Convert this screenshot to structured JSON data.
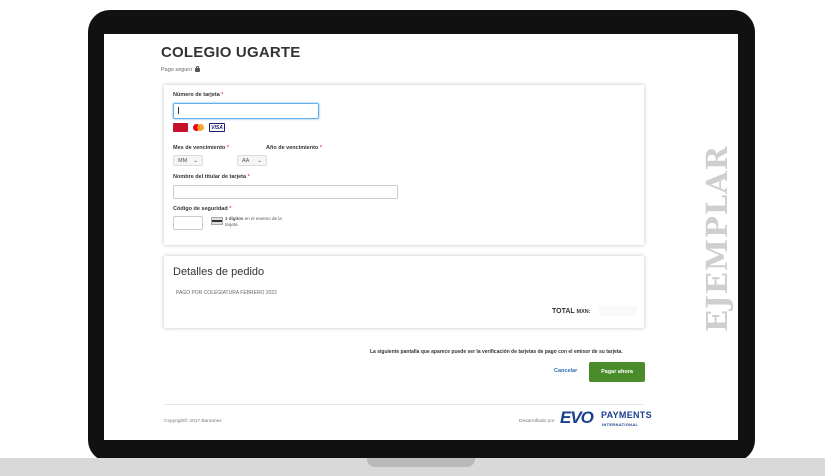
{
  "school_name": "COLEGIO UGARTE",
  "secure_payment_label": "Pago seguro",
  "card_number": {
    "label": "Número de tarjeta",
    "required_mark": "*",
    "value": ""
  },
  "card_brands": {
    "amex": "amex-card-icon",
    "mastercard": "mastercard-icon",
    "visa_text": "VISA"
  },
  "expiry_month": {
    "label": "Mes de vencimiento",
    "required_mark": "*",
    "selected": "MM"
  },
  "expiry_year": {
    "label": "Año de vencimiento",
    "required_mark": "*",
    "selected": "AA"
  },
  "cardholder_name": {
    "label": "Nombre del titular de tarjeta",
    "required_mark": "*",
    "value": ""
  },
  "security_code": {
    "label": "Código de seguridad",
    "required_mark": "*",
    "hint_bold": "3 dígitos",
    "hint_rest": "en el reverso de la tarjeta",
    "value": ""
  },
  "order_details": {
    "title": "Detalles de pedido",
    "description": "PAGO POR COLEGIATURA FEBRERO 2022",
    "total_label": "TOTAL",
    "currency": "MXN:"
  },
  "notice": "La siguiente pantalla que aparece puede ser la verificación de tarjetas de pago con el emisor de su tarjeta.",
  "cancel_label": "Cancelar",
  "pay_label": "Pagar ahora",
  "copyright": "Copyright© 2017 Banamex",
  "developed_by": "Desarrollado por",
  "logo": {
    "evo": "EVO",
    "payments": "PAYMENTS",
    "international": "INTERNATIONAL"
  },
  "watermark": "EJEMPLAR",
  "colors": {
    "pay_button": "#4a8c2a",
    "cancel_link": "#2a6db3",
    "required": "#d9534f",
    "focus_border": "#66afe9",
    "evo_blue": "#1b3f8f"
  }
}
